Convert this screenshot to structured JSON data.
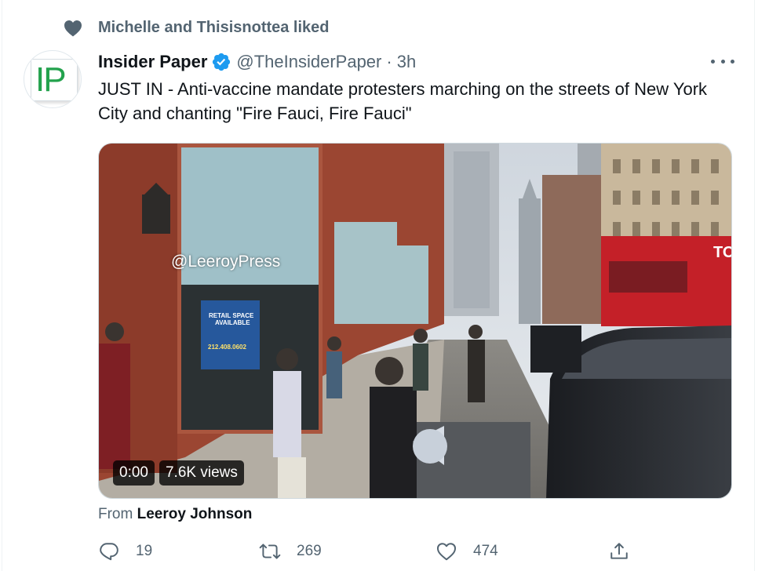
{
  "social_context": {
    "icon": "heart-icon",
    "text": "Michelle and Thisisnottea liked"
  },
  "author": {
    "avatar_text": "IP",
    "name": "Insider Paper",
    "handle": "@TheInsiderPaper",
    "separator": "·",
    "time": "3h",
    "verified": true
  },
  "tweet": {
    "text": "JUST IN - Anti-vaccine mandate protesters marching on the streets of New York City and chanting \"Fire Fauci, Fire Fauci\""
  },
  "media": {
    "watermark": "@LeeroyPress",
    "sign_line1": "RETAIL SPACE",
    "sign_line2": "AVAILABLE",
    "sign_phone": "212.408.0602",
    "bus_text": "TO",
    "video_time": "0:00",
    "views": "7.6K views"
  },
  "attribution": {
    "prefix": "From",
    "name": "Leeroy Johnson"
  },
  "actions": {
    "replies": "19",
    "retweets": "269",
    "likes": "474"
  },
  "colors": {
    "secondary_text": "#536471",
    "verified_blue": "#1d9bf0",
    "logo_green": "#23a24d"
  }
}
